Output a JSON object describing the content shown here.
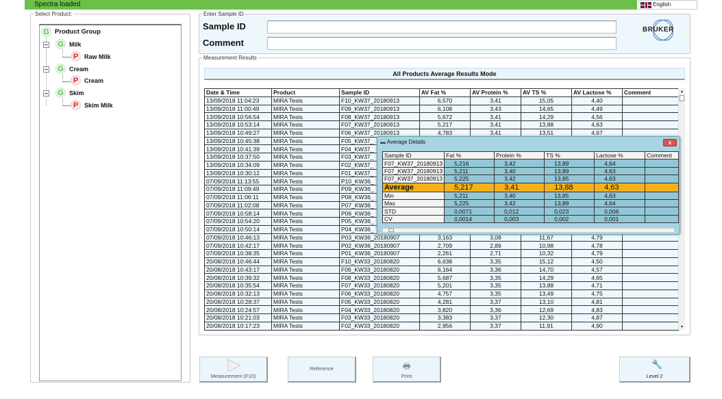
{
  "status": "Spectra loaded",
  "language": "English",
  "select_product": {
    "legend": "Select Product:",
    "tree": [
      {
        "label": "Product Group",
        "type": "G"
      },
      {
        "label": "Milk",
        "type": "G"
      },
      {
        "label": "Raw Milk",
        "type": "P"
      },
      {
        "label": "Cream",
        "type": "G"
      },
      {
        "label": "Cream",
        "type": "P"
      },
      {
        "label": "Skim",
        "type": "G"
      },
      {
        "label": "Skim Milk",
        "type": "P"
      }
    ]
  },
  "entry": {
    "legend": "Enter Sample ID",
    "sample_id_label": "Sample ID",
    "sample_id_value": "",
    "comment_label": "Comment",
    "comment_value": "",
    "logo": "BRUKER"
  },
  "results": {
    "legend": "Measurement Results",
    "mode": "All Products Average Results Mode",
    "columns": [
      "Date & Time",
      "Product",
      "Sample ID",
      "AV Fat %",
      "AV Protein %",
      "AV TS %",
      "AV Lactose %",
      "Comment"
    ],
    "rows": [
      [
        "13/09/2018 11:04:23",
        "MIRA Tests",
        "F10_KW37_20180913",
        "6,570",
        "3,41",
        "15,05",
        "4,40",
        ""
      ],
      [
        "13/09/2018 11:00:49",
        "MIRA Tests",
        "F09_KW37_20180913",
        "6,108",
        "3,43",
        "14,65",
        "4,49",
        ""
      ],
      [
        "13/09/2018 10:56:54",
        "MIRA Tests",
        "F08_KW37_20180913",
        "5,672",
        "3,41",
        "14,29",
        "4,56",
        ""
      ],
      [
        "13/09/2018 10:53:14",
        "MIRA Tests",
        "F07_KW37_20180913",
        "5,217",
        "3,41",
        "13,88",
        "4,63",
        ""
      ],
      [
        "13/09/2018 10:49:27",
        "MIRA Tests",
        "F06_KW37_20180913",
        "4,783",
        "3,41",
        "13,51",
        "4,67",
        ""
      ],
      [
        "13/09/2018 10:45:38",
        "MIRA Tests",
        "F05_KW37_",
        "",
        "",
        "",
        "",
        ""
      ],
      [
        "13/09/2018 10:41:39",
        "MIRA Tests",
        "F04_KW37_",
        "",
        "",
        "",
        "",
        ""
      ],
      [
        "13/09/2018 10:37:50",
        "MIRA Tests",
        "F03_KW37_",
        "",
        "",
        "",
        "",
        ""
      ],
      [
        "13/09/2018 10:34:09",
        "MIRA Tests",
        "F02_KW37_",
        "",
        "",
        "",
        "",
        ""
      ],
      [
        "13/09/2018 10:30:12",
        "MIRA Tests",
        "F01_KW37_",
        "",
        "",
        "",
        "",
        ""
      ],
      [
        "07/09/2018 11:13:55",
        "MIRA Tests",
        "P10_KW36_",
        "",
        "",
        "",
        "",
        ""
      ],
      [
        "07/09/2018 11:09:49",
        "MIRA Tests",
        "P09_KW36_",
        "",
        "",
        "",
        "",
        ""
      ],
      [
        "07/09/2018 11:06:11",
        "MIRA Tests",
        "P08_KW36_",
        "",
        "",
        "",
        "",
        ""
      ],
      [
        "07/09/2018 11:02:08",
        "MIRA Tests",
        "P07_KW36_",
        "",
        "",
        "",
        "",
        ""
      ],
      [
        "07/09/2018 10:58:14",
        "MIRA Tests",
        "P06_KW36_",
        "",
        "",
        "",
        "",
        ""
      ],
      [
        "07/09/2018 10:54:20",
        "MIRA Tests",
        "P05_KW36_",
        "",
        "",
        "",
        "",
        ""
      ],
      [
        "07/09/2018 10:50:14",
        "MIRA Tests",
        "P04_KW36_",
        "",
        "",
        "",
        "",
        ""
      ],
      [
        "07/09/2018 10:46:13",
        "MIRA Tests",
        "P03_KW36_20180907",
        "3,163",
        "3,08",
        "11,67",
        "4,79",
        ""
      ],
      [
        "07/09/2018 10:42:17",
        "MIRA Tests",
        "P02_KW36_20180907",
        "2,709",
        "2,89",
        "10,98",
        "4,78",
        ""
      ],
      [
        "07/09/2018 10:38:35",
        "MIRA Tests",
        "P01_KW36_20180907",
        "2,261",
        "2,71",
        "10,32",
        "4,79",
        ""
      ],
      [
        "20/08/2018 10:46:44",
        "MIRA Tests",
        "F10_KW33_20180820",
        "6,638",
        "3,35",
        "15,12",
        "4,50",
        ""
      ],
      [
        "20/08/2018 10:43:17",
        "MIRA Tests",
        "F09_KW33_20180820",
        "6,164",
        "3,36",
        "14,70",
        "4,57",
        ""
      ],
      [
        "20/08/2018 10:39:32",
        "MIRA Tests",
        "F08_KW33_20180820",
        "5,687",
        "3,35",
        "14,29",
        "4,65",
        ""
      ],
      [
        "20/08/2018 10:35:54",
        "MIRA Tests",
        "F07_KW33_20180820",
        "5,201",
        "3,35",
        "13,88",
        "4,71",
        ""
      ],
      [
        "20/08/2018 10:32:13",
        "MIRA Tests",
        "F06_KW33_20180820",
        "4,757",
        "3,35",
        "13,49",
        "4,75",
        ""
      ],
      [
        "20/08/2018 10:28:37",
        "MIRA Tests",
        "F05_KW33_20180820",
        "4,281",
        "3,37",
        "13,10",
        "4,81",
        ""
      ],
      [
        "20/08/2018 10:24:57",
        "MIRA Tests",
        "F04_KW33_20180820",
        "3,820",
        "3,36",
        "12,69",
        "4,83",
        ""
      ],
      [
        "20/08/2018 10:21:03",
        "MIRA Tests",
        "F03_KW33_20180820",
        "3,383",
        "3,37",
        "12,30",
        "4,87",
        ""
      ],
      [
        "20/08/2018 10:17:23",
        "MIRA Tests",
        "F02_KW33_20180820",
        "2,956",
        "3,37",
        "11,91",
        "4,90",
        ""
      ]
    ]
  },
  "popup": {
    "title": "Average Details",
    "close": "x",
    "columns": [
      "Sample ID",
      "Fat %",
      "Protein %",
      "TS %",
      "Lactose %",
      "Comment"
    ],
    "rows": [
      [
        "F07_KW37_20180913",
        "5,216",
        "3,42",
        "13,89",
        "4,64",
        ""
      ],
      [
        "F07_KW37_20180913",
        "5,211",
        "3,40",
        "13,89",
        "4,63",
        ""
      ],
      [
        "F07_KW37_20180913",
        "5,225",
        "3,42",
        "13,85",
        "4,63",
        ""
      ],
      [
        "Average",
        "5,217",
        "3,41",
        "13,88",
        "4,63",
        ""
      ],
      [
        "Min",
        "5,211",
        "3,40",
        "13,85",
        "4,63",
        ""
      ],
      [
        "Max",
        "5,225",
        "3,42",
        "13,89",
        "4,64",
        ""
      ],
      [
        "STD",
        "0,0071",
        "0,012",
        "0,023",
        "0,006",
        ""
      ],
      [
        "CV",
        "0,0014",
        "0,003",
        "0,002",
        "0,001",
        ""
      ]
    ]
  },
  "buttons": {
    "measurement": "Measurement (F10)",
    "reference": "Reference",
    "print": "Print",
    "level": "Level 2"
  },
  "colors": {
    "status_bar": "#6cc04a",
    "average_row": "#f7b01a",
    "popup_cells": "#93c7d6"
  }
}
